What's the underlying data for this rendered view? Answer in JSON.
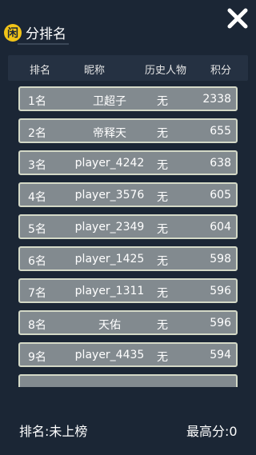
{
  "app": {
    "logo_char": "闲",
    "title": "分排名"
  },
  "columns": {
    "rank": "排名",
    "nickname": "昵称",
    "history": "历史人物",
    "score": "积分"
  },
  "rows": [
    {
      "rank": "1名",
      "nickname": "卫超子",
      "history": "无",
      "score": "2338"
    },
    {
      "rank": "2名",
      "nickname": "帝释天",
      "history": "无",
      "score": "655"
    },
    {
      "rank": "3名",
      "nickname": "player_4242",
      "history": "无",
      "score": "638"
    },
    {
      "rank": "4名",
      "nickname": "player_3576",
      "history": "无",
      "score": "605"
    },
    {
      "rank": "5名",
      "nickname": "player_2349",
      "history": "无",
      "score": "604"
    },
    {
      "rank": "6名",
      "nickname": "player_1425",
      "history": "无",
      "score": "598"
    },
    {
      "rank": "7名",
      "nickname": "player_1311",
      "history": "无",
      "score": "596"
    },
    {
      "rank": "8名",
      "nickname": "天佑",
      "history": "无",
      "score": "596"
    },
    {
      "rank": "9名",
      "nickname": "player_4435",
      "history": "无",
      "score": "594"
    }
  ],
  "footer": {
    "my_rank": "排名:未上榜",
    "best_score": "最高分:0"
  },
  "icons": {
    "close": "close-icon",
    "logo": "logo-icon"
  },
  "colors": {
    "background": "#1b2635",
    "row_fill": "#828a8f",
    "row_border": "#d4d9c7",
    "logo": "#f2c418"
  }
}
